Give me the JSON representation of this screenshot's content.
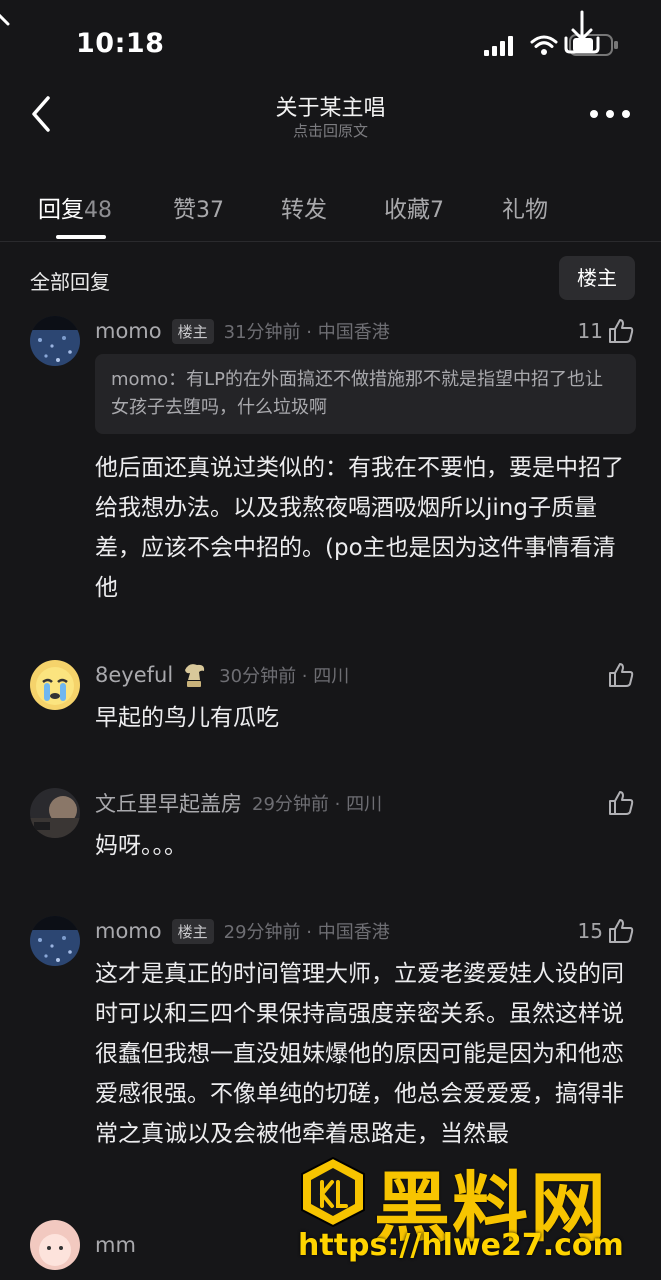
{
  "status_bar": {
    "time": "10:18"
  },
  "nav": {
    "title": "关于某主唱",
    "subtitle": "点击回原文"
  },
  "tabs": [
    {
      "label": "回复",
      "count": "48"
    },
    {
      "label": "赞",
      "count": "37"
    },
    {
      "label": "转发",
      "count": ""
    },
    {
      "label": "收藏",
      "count": "7"
    },
    {
      "label": "礼物",
      "count": ""
    }
  ],
  "section": {
    "label": "全部回复",
    "filter_button": "楼主"
  },
  "comments": [
    {
      "name": "momo",
      "badge": "楼主",
      "time_loc": "31分钟前 · 中国香港",
      "likes": "11",
      "quote": "momo：有LP的在外面搞还不做措施那不就是指望中招了也让女孩子去堕吗，什么垃圾啊",
      "text": "他后面还真说过类似的：有我在不要怕，要是中招了给我想办法。以及我熬夜喝酒吸烟所以jing子质量差，应该不会中招的。(po主也是因为这件事情看清他"
    },
    {
      "name": "8eyeful",
      "time_loc": "30分钟前 · 四川",
      "likes": "",
      "text": "早起的鸟儿有瓜吃"
    },
    {
      "name": "文丘里早起盖房",
      "time_loc": "29分钟前 · 四川",
      "likes": "",
      "text": "妈呀。。。"
    },
    {
      "name": "momo",
      "badge": "楼主",
      "time_loc": "29分钟前 · 中国香港",
      "likes": "15",
      "text": "这才是真正的时间管理大师，立爱老婆爱娃人设的同时可以和三四个果保持高强度亲密关系。虽然这样说很蠢但我想一直没姐妹爆他的原因可能是因为和他恋爱感很强。不像单纯的切磋，他总会爱爱爱，搞得非常之真诚以及会被他牵着思路走，当然最"
    },
    {
      "name": "mm"
    }
  ],
  "watermark": {
    "text": "黑料网",
    "url": "https://hlwe27.com"
  }
}
